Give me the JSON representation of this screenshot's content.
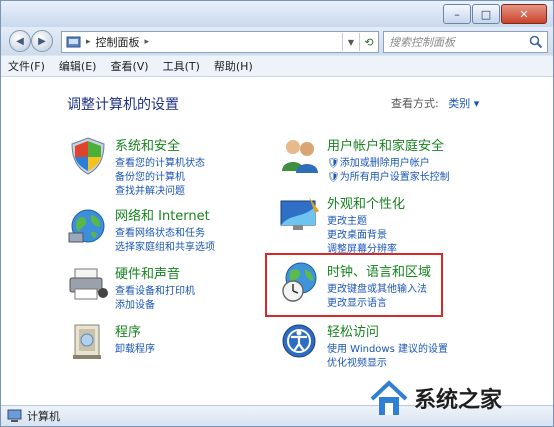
{
  "window": {
    "caption_buttons": {
      "minimize": "–",
      "maximize": "□",
      "close": "✕"
    }
  },
  "address_bar": {
    "breadcrumb": "控制面板",
    "separator": "▸",
    "search_placeholder": "搜索控制面板"
  },
  "menu": [
    "文件(F)",
    "编辑(E)",
    "查看(V)",
    "工具(T)",
    "帮助(H)"
  ],
  "main": {
    "heading": "调整计算机的设置",
    "view_by_label": "查看方式:",
    "view_by_value": "类别",
    "categories": [
      {
        "title": "系统和安全",
        "links": [
          "查看您的计算机状态",
          "备份您的计算机",
          "查找并解决问题"
        ]
      },
      {
        "title": "网络和 Internet",
        "links": [
          "查看网络状态和任务",
          "选择家庭组和共享选项"
        ]
      },
      {
        "title": "硬件和声音",
        "links": [
          "查看设备和打印机",
          "添加设备"
        ]
      },
      {
        "title": "程序",
        "links": [
          "卸载程序"
        ]
      },
      {
        "title": "用户帐户和家庭安全",
        "links": [
          "添加或删除用户帐户",
          "为所有用户设置家长控制"
        ]
      },
      {
        "title": "外观和个性化",
        "links": [
          "更改主题",
          "更改桌面背景",
          "调整屏幕分辨率"
        ]
      },
      {
        "title": "时钟、语言和区域",
        "links": [
          "更改键盘或其他输入法",
          "更改显示语言"
        ]
      },
      {
        "title": "轻松访问",
        "links": [
          "使用 Windows 建议的设置",
          "优化视频显示"
        ]
      }
    ]
  },
  "status_bar": {
    "label": "计算机"
  },
  "watermark": {
    "text": "系统之家"
  },
  "colors": {
    "category_title": "#17841f",
    "link": "#1a56b8",
    "heading": "#1e3287",
    "highlight": "#d42a2a"
  }
}
